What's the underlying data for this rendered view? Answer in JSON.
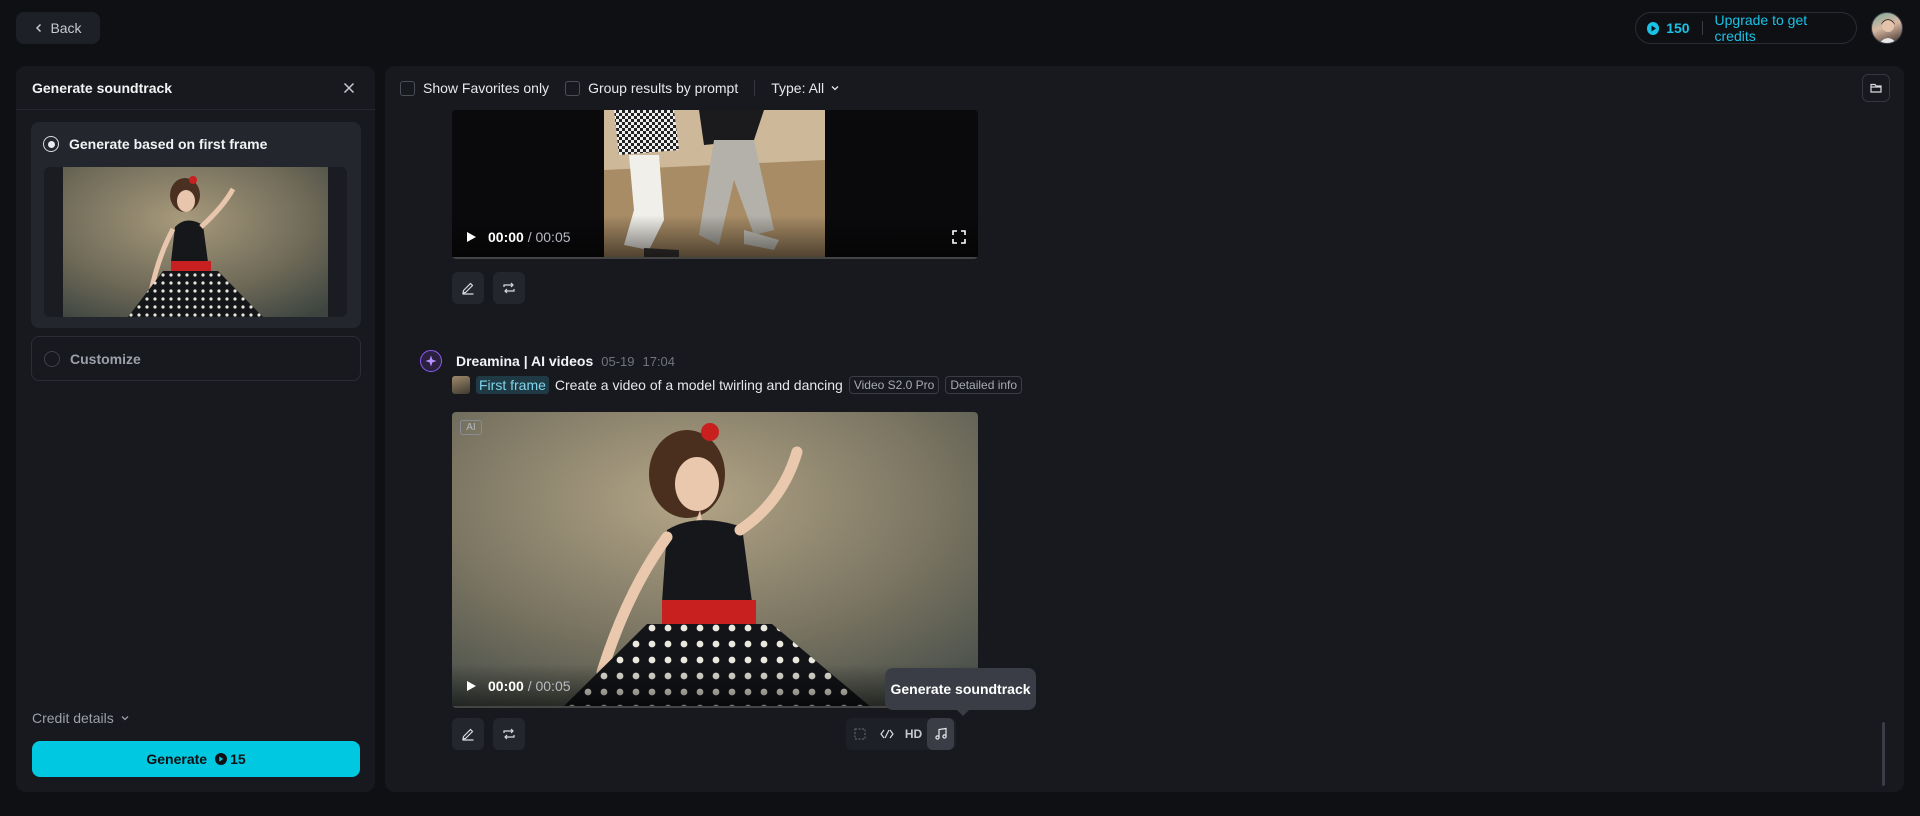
{
  "topbar": {
    "back_label": "Back",
    "credits": "150",
    "upgrade_label": "Upgrade to get credits"
  },
  "panel": {
    "title": "Generate soundtrack",
    "option_first_frame": "Generate based on first frame",
    "option_customize": "Customize",
    "credit_details": "Credit details",
    "generate_label": "Generate",
    "generate_cost": "15"
  },
  "toolbar": {
    "favorites_label": "Show Favorites only",
    "group_label": "Group results by prompt",
    "type_label": "Type: All"
  },
  "video1": {
    "time_current": "00:00",
    "time_total": "/ 00:05"
  },
  "message": {
    "bot_name": "Dreamina | AI videos",
    "date": "05-19",
    "time": "17:04",
    "first_frame_label": "First frame",
    "prompt": "Create a video of a model twirling and dancing",
    "model_tag": "Video S2.0 Pro",
    "info_tag": "Detailed info",
    "ai_badge": "AI",
    "time_current": "00:00",
    "time_total": "/ 00:05",
    "hd_label": "HD",
    "tooltip": "Generate soundtrack"
  },
  "colors": {
    "accent": "#00c8e0",
    "background": "#0f1014",
    "panel": "#17191e"
  }
}
